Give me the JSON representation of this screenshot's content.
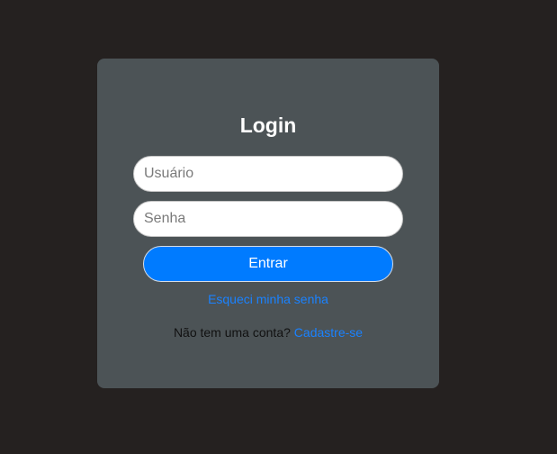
{
  "login_card": {
    "title": "Login",
    "username": {
      "placeholder": "Usuário",
      "value": ""
    },
    "password": {
      "placeholder": "Senha",
      "value": ""
    },
    "submit_label": "Entrar",
    "forgot_password_link": "Esqueci minha senha",
    "signup_prompt": "Não tem uma conta?",
    "signup_link": "Cadastre-se"
  },
  "colors": {
    "page_background": "#252120",
    "card_background": "#4c5356",
    "accent": "#007bff",
    "link": "#1a82ff"
  }
}
